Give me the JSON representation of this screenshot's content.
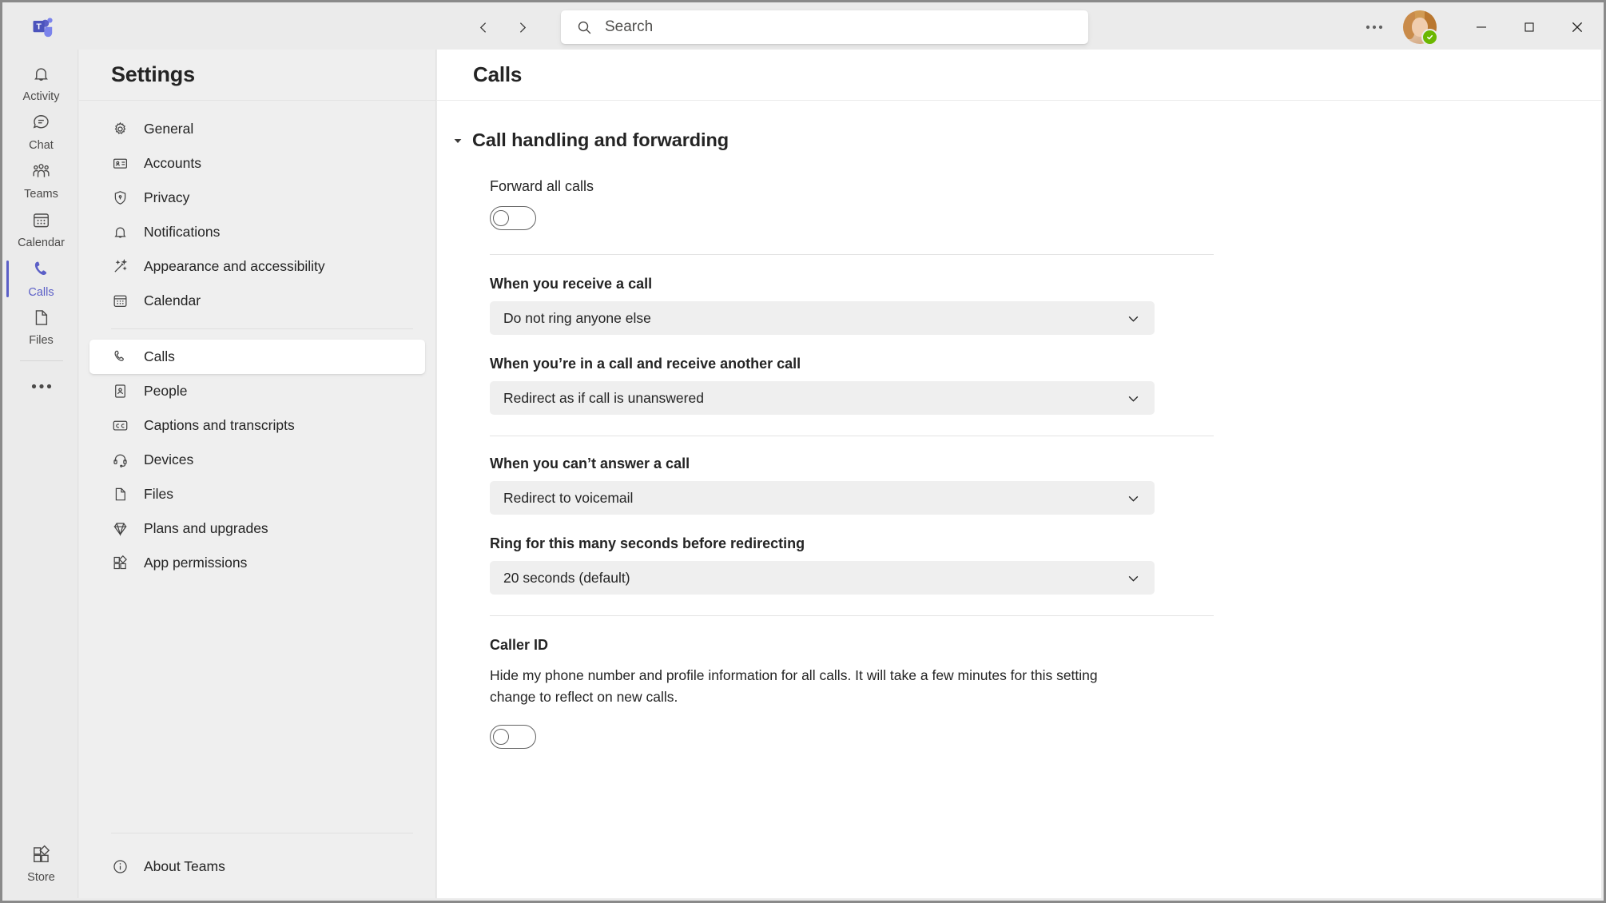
{
  "titlebar": {
    "logo_icon": "teams-logo-icon",
    "back_icon": "chevron-left-icon",
    "forward_icon": "chevron-right-icon",
    "search_icon": "search-icon",
    "search_value": "",
    "search_placeholder": "Search",
    "more_label": "···",
    "avatar_name": "user-avatar",
    "presence_status": "available",
    "presence_glyph": "✓",
    "minimize_glyph": "–",
    "maximize_glyph": "□",
    "close_glyph": "✕"
  },
  "rail": {
    "items": [
      {
        "label": "Activity",
        "icon": "bell-icon",
        "active": false
      },
      {
        "label": "Chat",
        "icon": "chat-icon",
        "active": false
      },
      {
        "label": "Teams",
        "icon": "teams-people-icon",
        "active": false
      },
      {
        "label": "Calendar",
        "icon": "calendar-icon",
        "active": false
      },
      {
        "label": "Calls",
        "icon": "phone-icon",
        "active": true
      },
      {
        "label": "Files",
        "icon": "file-icon",
        "active": false
      }
    ],
    "more_label": "•••",
    "store": {
      "label": "Store",
      "icon": "store-icon"
    }
  },
  "sidebar": {
    "title": "Settings",
    "items": [
      {
        "label": "General",
        "icon": "gear-icon",
        "active": false
      },
      {
        "label": "Accounts",
        "icon": "id-card-icon",
        "active": false
      },
      {
        "label": "Privacy",
        "icon": "shield-lock-icon",
        "active": false
      },
      {
        "label": "Notifications",
        "icon": "bell-icon",
        "active": false
      },
      {
        "label": "Appearance and accessibility",
        "icon": "wand-icon",
        "active": false
      },
      {
        "label": "Calendar",
        "icon": "calendar-icon",
        "active": false
      },
      {
        "label": "Calls",
        "icon": "phone-icon",
        "active": true
      },
      {
        "label": "People",
        "icon": "contact-card-icon",
        "active": false
      },
      {
        "label": "Captions and transcripts",
        "icon": "closed-captions-icon",
        "active": false
      },
      {
        "label": "Devices",
        "icon": "headset-icon",
        "active": false
      },
      {
        "label": "Files",
        "icon": "file-icon",
        "active": false
      },
      {
        "label": "Plans and upgrades",
        "icon": "diamond-icon",
        "active": false
      },
      {
        "label": "App permissions",
        "icon": "apps-icon",
        "active": false
      }
    ],
    "about": {
      "label": "About Teams",
      "icon": "info-circle-icon"
    }
  },
  "main": {
    "title": "Calls",
    "section": {
      "title": "Call handling and forwarding",
      "caret_icon": "caret-down-icon",
      "expanded": true
    },
    "forward_all_calls": {
      "label": "Forward all calls",
      "toggle_state": "off"
    },
    "when_receive_call": {
      "label": "When you receive a call",
      "value": "Do not ring anyone else",
      "chevron_icon": "chevron-down-icon"
    },
    "when_in_call": {
      "label": "When you’re in a call and receive another call",
      "value": "Redirect as if call is unanswered",
      "chevron_icon": "chevron-down-icon"
    },
    "when_cant_answer": {
      "label": "When you can’t answer a call",
      "value": "Redirect to voicemail",
      "chevron_icon": "chevron-down-icon"
    },
    "ring_seconds": {
      "label": "Ring for this many seconds before redirecting",
      "value": "20 seconds (default)",
      "chevron_icon": "chevron-down-icon"
    },
    "caller_id": {
      "label": "Caller ID",
      "description": "Hide my phone number and profile information for all calls. It will take a few minutes for this setting change to reflect on new calls.",
      "toggle_state": "off"
    }
  },
  "colors": {
    "accent": "#5b5fc7",
    "presence_green": "#6bb700",
    "text": "#242424",
    "panel_bg": "#efefef",
    "content_bg": "#ffffff"
  }
}
